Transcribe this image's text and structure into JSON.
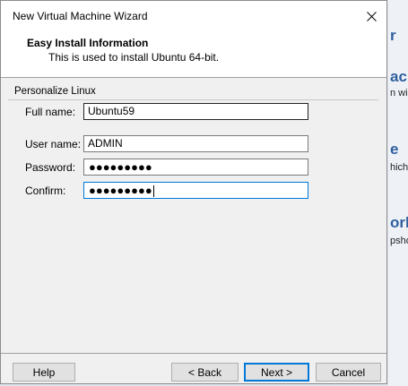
{
  "window": {
    "title": "New Virtual Machine Wizard"
  },
  "header": {
    "title": "Easy Install Information",
    "subtitle": "This is used to install Ubuntu 64-bit."
  },
  "group": {
    "label": "Personalize Linux"
  },
  "fields": {
    "full_name": {
      "label": "Full name:",
      "value": "Ubuntu59"
    },
    "user_name": {
      "label": "User name:",
      "value": "ADMIN"
    },
    "password": {
      "label": "Password:",
      "masked": "●●●●●●●●●"
    },
    "confirm": {
      "label": "Confirm:",
      "masked": "●●●●●●●●●"
    }
  },
  "buttons": {
    "help": "Help",
    "back": "< Back",
    "next": "Next >",
    "cancel": "Cancel"
  },
  "background_app": {
    "frag1": "r",
    "frag2": "ach",
    "frag3": "n will",
    "frag4": "e",
    "frag5": "hich v",
    "frag6": "orks",
    "frag7": "pshot"
  },
  "colors": {
    "focus": "#0078d7",
    "accent": "#2f5f9e"
  }
}
